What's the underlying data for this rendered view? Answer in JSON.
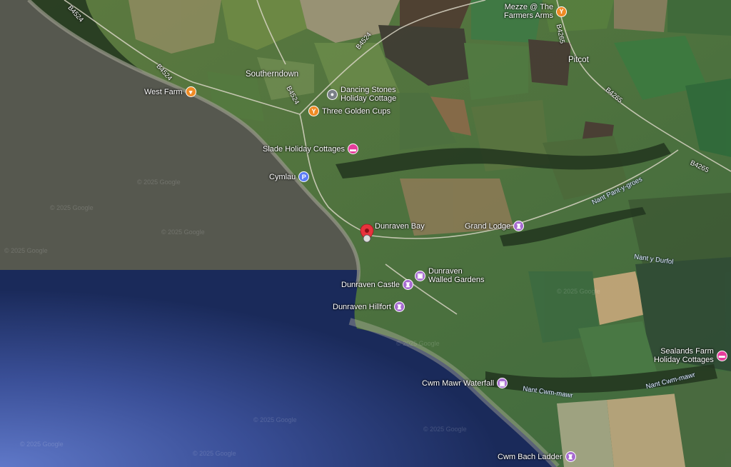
{
  "places": {
    "southerndown": "Southerndown",
    "pitcot": "Pitcot"
  },
  "pois": {
    "dancing_stones": "Dancing Stones\nHoliday Cottage",
    "mezze": "Mezze @ The\nFarmers Arms",
    "west_farm": "West Farm",
    "three_golden_cups": "Three Golden Cups",
    "slade": "Slade Holiday Cottages",
    "cymlau": "Cymlau",
    "dunraven_bay": "Dunraven Bay",
    "grand_lodge": "Grand Lodge",
    "walled_gardens": "Dunraven\nWalled Gardens",
    "castle": "Dunraven Castle",
    "hillfort": "Dunraven Hillfort",
    "sealands": "Sealands Farm\nHoliday Cottages",
    "cwm_mawr": "Cwm Mawr Waterfall",
    "cwm_bach": "Cwm Bach Ladder"
  },
  "roads": {
    "b4524_a": "B4524",
    "b4524_b": "B4524",
    "b4524_c": "B4524",
    "b4524_d": "B4524",
    "b4265_a": "B4265",
    "b4265_b": "B4265",
    "b4265_c": "B4265"
  },
  "waterways": {
    "nant_pant": "Nant Pant-y-groes",
    "nant_durfol": "Nant y Durfol",
    "nant_cwm_a": "Nant Cwm-mawr",
    "nant_cwm_b": "Nant Cwm-mawr"
  },
  "watermark": "© 2025 Google",
  "colors": {
    "food_pin": "#f08a24",
    "lodging_pin": "#e53d9b",
    "attraction_pin": "#a86cd1",
    "parking_pin": "#5b7cf5",
    "gray_pin": "#7a7f87",
    "selected_pin": "#e8323c"
  },
  "icons": {
    "food": "glass-icon",
    "cafe": "cup-icon",
    "lodging": "bed-icon",
    "attraction": "landmark-icon",
    "parking": "parking-icon",
    "place": "pin-icon"
  }
}
